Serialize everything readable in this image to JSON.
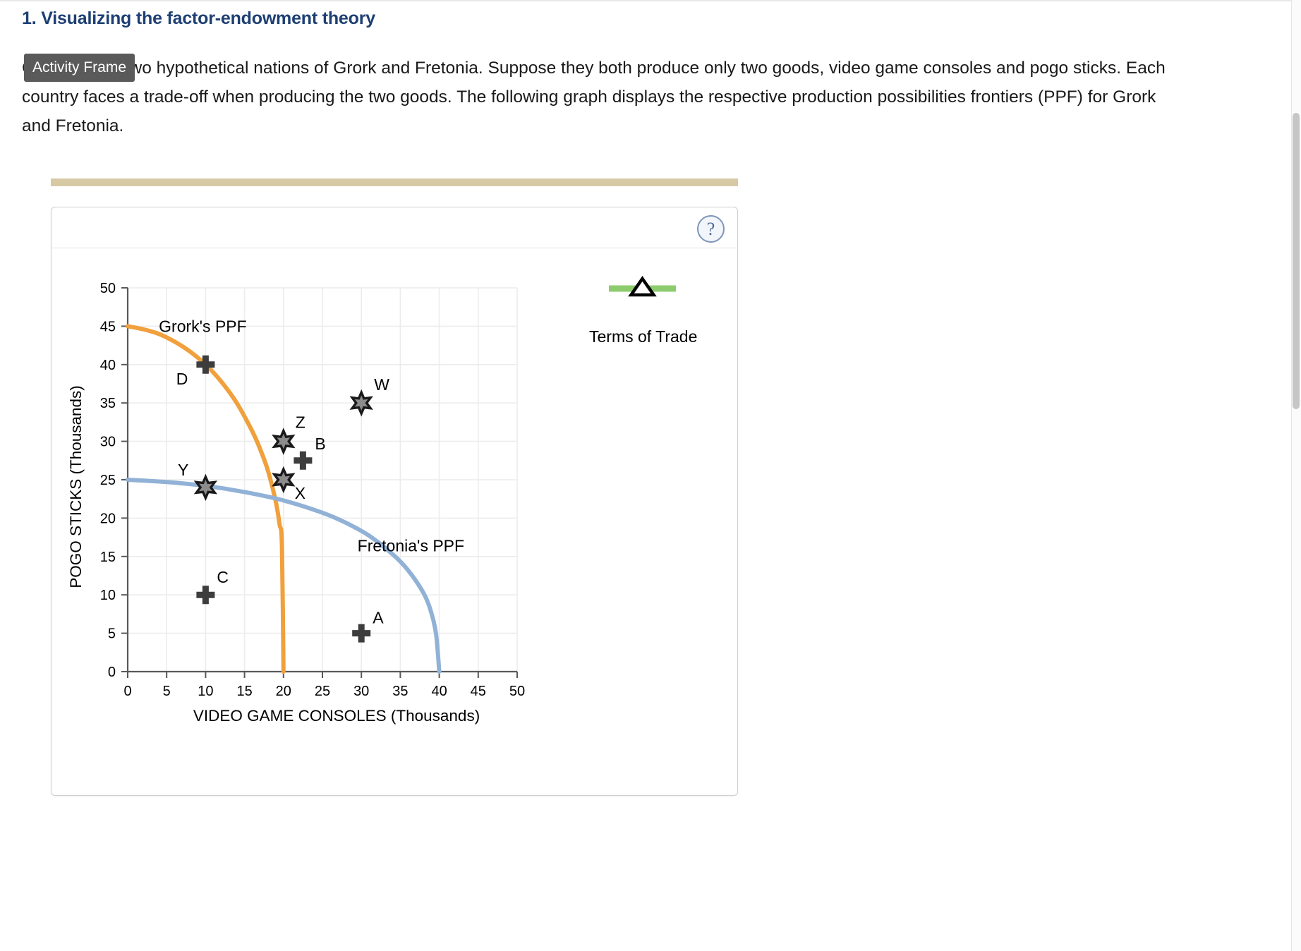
{
  "question": {
    "number_title": "1. Visualizing the factor-endowment theory",
    "paragraph_lines": [
      "Consider the two hypothetical nations of Grork and Fretonia. Suppose they both produce only two goods, video game consoles and pogo sticks. Each",
      "country faces a trade-off when producing the two goods. The following graph displays the respective production possibilities frontiers (PPF) for Grork",
      "and Fretonia."
    ]
  },
  "tooltip": {
    "label": "Activity Frame"
  },
  "panel": {
    "help_icon": "question-mark-icon",
    "help_label": "?"
  },
  "colors": {
    "heading": "#1d3f73",
    "grork_ppf": "#f0a03c",
    "fretonia_ppf": "#91b2d6",
    "terms_of_trade": "#8dcc6e",
    "marker_fill": "#8c8c8c",
    "marker_stroke": "#3a3a3a",
    "accent_bar": "#d6c9a4",
    "axis": "#595959",
    "grid": "#ececec"
  },
  "chart_data": {
    "type": "line",
    "title": "",
    "xlabel": "VIDEO GAME CONSOLES (Thousands)",
    "ylabel": "POGO STICKS (Thousands)",
    "xlim": [
      0,
      50
    ],
    "ylim": [
      0,
      50
    ],
    "xticks": [
      0,
      5,
      10,
      15,
      20,
      25,
      30,
      35,
      40,
      45,
      50
    ],
    "yticks": [
      0,
      5,
      10,
      15,
      20,
      25,
      30,
      35,
      40,
      45,
      50
    ],
    "xticklabels": [
      "0",
      "5",
      "10",
      "15",
      "20",
      "25",
      "30",
      "35",
      "40",
      "45",
      "50"
    ],
    "yticklabels": [
      "0",
      "5",
      "10",
      "15",
      "20",
      "25",
      "30",
      "35",
      "40",
      "45",
      "50"
    ],
    "grid": true,
    "legend_position": "right",
    "series": [
      {
        "name": "Grork's PPF",
        "kind": "curve",
        "color": "#f0a03c",
        "label_text": "Grork's PPF",
        "label_x": 4.0,
        "label_y": 45.0,
        "x_intercept": 20,
        "y_intercept": 45,
        "points": [
          [
            0,
            45.0
          ],
          [
            2,
            44.6
          ],
          [
            4,
            44.0
          ],
          [
            6,
            43.0
          ],
          [
            8,
            41.7
          ],
          [
            10,
            40.0
          ],
          [
            12,
            37.8
          ],
          [
            14,
            35.0
          ],
          [
            16,
            31.3
          ],
          [
            17,
            29.0
          ],
          [
            18,
            26.2
          ],
          [
            19,
            22.2
          ],
          [
            19.5,
            19.2
          ],
          [
            19.8,
            16.4
          ],
          [
            20,
            0
          ]
        ]
      },
      {
        "name": "Fretonia's PPF",
        "kind": "curve",
        "color": "#91b2d6",
        "label_text": "Fretonia's PPF",
        "label_x": 29.5,
        "label_y": 16.4,
        "x_intercept": 40,
        "y_intercept": 25,
        "points": [
          [
            0,
            25.0
          ],
          [
            5,
            24.7
          ],
          [
            10,
            24.2
          ],
          [
            15,
            23.4
          ],
          [
            20,
            22.3
          ],
          [
            25,
            20.7
          ],
          [
            28,
            19.4
          ],
          [
            31,
            17.7
          ],
          [
            34,
            15.3
          ],
          [
            36,
            13.2
          ],
          [
            38,
            10.2
          ],
          [
            39,
            7.6
          ],
          [
            39.6,
            4.8
          ],
          [
            40,
            0
          ]
        ]
      }
    ],
    "legend_entries": [
      {
        "label": "Terms of Trade",
        "color": "#8dcc6e",
        "marker": "triangle-up-open"
      }
    ],
    "annotated_points": [
      {
        "label": "A",
        "x": 30,
        "y": 5,
        "marker": "plus",
        "label_dx": 16,
        "label_dy": -14
      },
      {
        "label": "B",
        "x": 22.5,
        "y": 27.5,
        "marker": "plus",
        "label_dx": 17,
        "label_dy": -16
      },
      {
        "label": "C",
        "x": 10,
        "y": 10,
        "marker": "plus",
        "label_dx": 16,
        "label_dy": -17
      },
      {
        "label": "D",
        "x": 10,
        "y": 40,
        "marker": "plus",
        "label_dx": -25,
        "label_dy": 28
      },
      {
        "label": "W",
        "x": 30,
        "y": 35,
        "marker": "star6",
        "label_dx": 18,
        "label_dy": -18
      },
      {
        "label": "X",
        "x": 20,
        "y": 25,
        "marker": "star6",
        "label_dx": 16,
        "label_dy": 27
      },
      {
        "label": "Y",
        "x": 10,
        "y": 24,
        "marker": "star6",
        "label_dx": -24,
        "label_dy": -17
      },
      {
        "label": "Z",
        "x": 20,
        "y": 30,
        "marker": "star6",
        "label_dx": 17,
        "label_dy": -19
      }
    ]
  }
}
